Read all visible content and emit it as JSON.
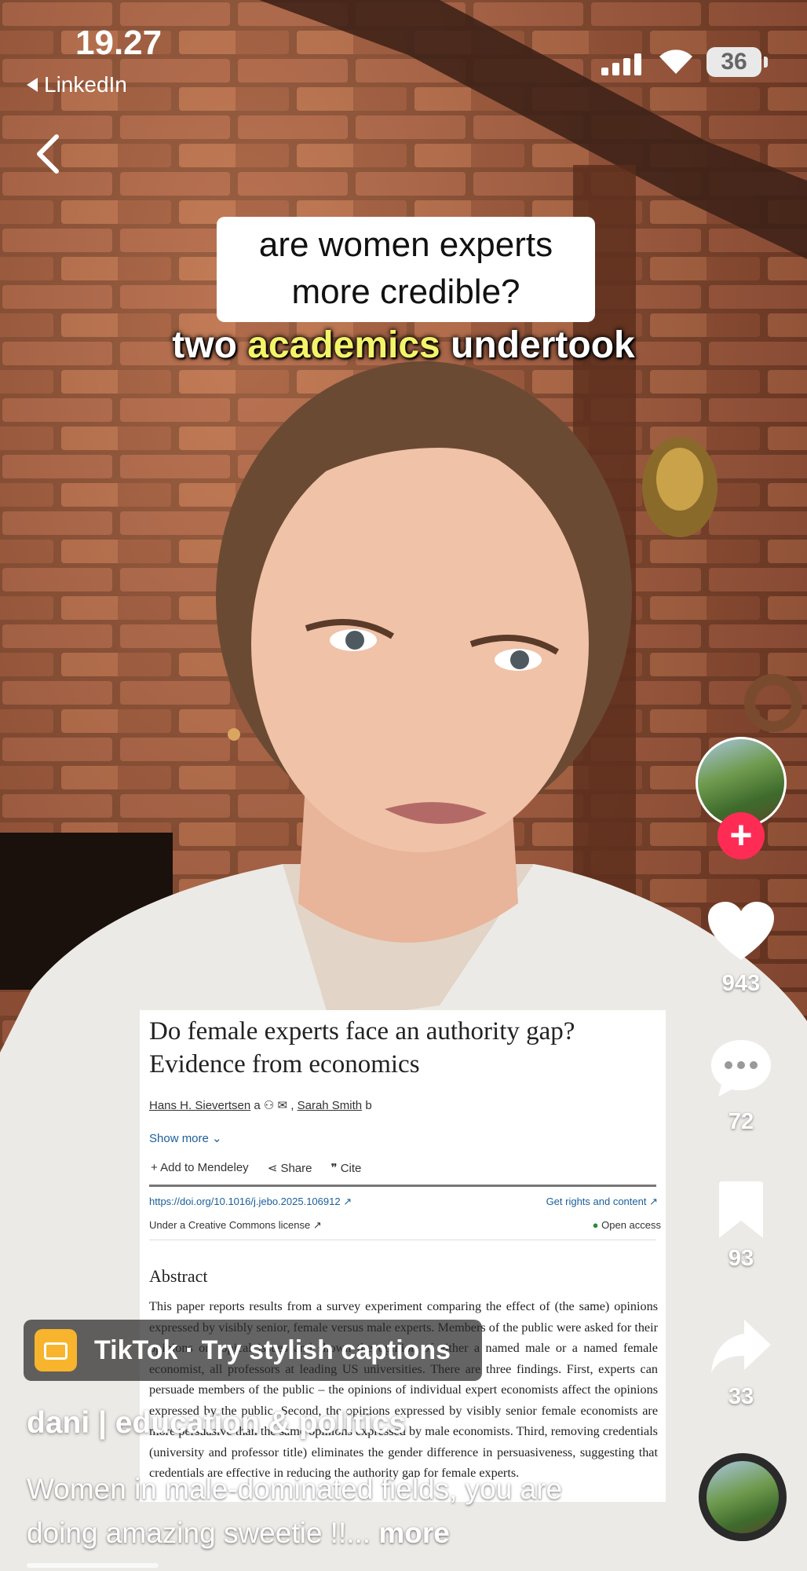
{
  "status_bar": {
    "time": "19.27",
    "back_app": "LinkedIn",
    "battery": "36"
  },
  "video": {
    "caption_box": [
      "are women experts",
      "more credible?"
    ],
    "subtitle": {
      "before": "two ",
      "highlight": "academics",
      "after": " undertook"
    }
  },
  "paper": {
    "title": "Do female experts face an authority gap? Evidence from economics",
    "authors": [
      "Hans H. Sievertsen",
      "Sarah Smith"
    ],
    "show_more": "Show more",
    "tools": [
      "Add to Mendeley",
      "Share",
      "Cite"
    ],
    "doi": "https://doi.org/10.1016/j.jebo.2025.106912",
    "rights": "Get rights and content",
    "license": "Under a Creative Commons license",
    "open_access": "Open access",
    "abstract_heading": "Abstract",
    "abstract": "This paper reports results from a survey experiment comparing the effect of (the same) opinions expressed by visibly senior, female versus male experts. Members of the public were asked for their opinions on topical issues and shown the opinion of either a named male or a named female economist, all professors at leading US universities. There are three findings. First, experts can persuade members of the public – the opinions of individual expert economists affect the opinions expressed by the public. Second, the opinions expressed by visibly senior female economists are more persuasive than the same opinions expressed by male economists. Third, removing credentials (university and professor title) eliminates the gender difference in persuasiveness, suggesting that credentials are effective in reducing the authority gap for female experts."
  },
  "rail": {
    "likes": "943",
    "comments": "72",
    "saves": "93",
    "shares": "33"
  },
  "promo": {
    "text": "TikTok · Try stylish captions"
  },
  "post": {
    "username": "dani | education & politics",
    "description": "Women in male-dominated fields, you are doing amazing  sweetie !!...",
    "more": "more"
  },
  "colors": {
    "like_accent": "#fe2c55",
    "highlight": "#f3f46a"
  }
}
